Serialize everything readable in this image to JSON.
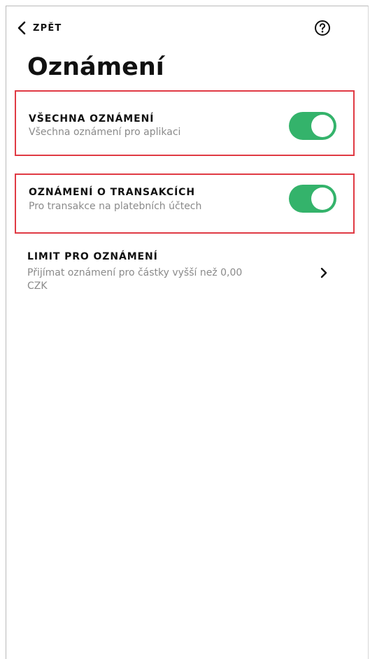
{
  "header": {
    "back_label": "ZPĚT",
    "back_icon": "chevron-left-icon",
    "help_icon": "question-circle-icon"
  },
  "page": {
    "title": "Oznámení"
  },
  "settings": [
    {
      "label": "VŠECHNA OZNÁMENÍ",
      "description": "Všechna oznámení pro aplikaci",
      "toggle_on": true,
      "highlighted": true
    },
    {
      "label": "OZNÁMENÍ O TRANSAKCÍCH",
      "description": "Pro transakce na platebních účtech",
      "toggle_on": true,
      "highlighted": true
    }
  ],
  "limit": {
    "label": "LIMIT PRO OZNÁMENÍ",
    "description": "Přijímat oznámení pro částky vyšší než 0,00 CZK",
    "icon": "chevron-right-icon"
  },
  "colors": {
    "toggle_on": "#34b36b",
    "highlight_border": "#e03a44",
    "secondary_text": "#8a8a8a",
    "primary_text": "#111111"
  }
}
